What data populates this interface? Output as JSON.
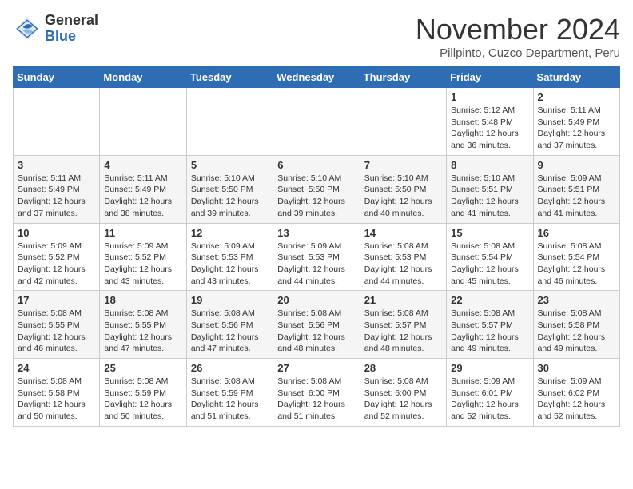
{
  "logo": {
    "general": "General",
    "blue": "Blue"
  },
  "header": {
    "title": "November 2024",
    "location": "Pillpinto, Cuzco Department, Peru"
  },
  "weekdays": [
    "Sunday",
    "Monday",
    "Tuesday",
    "Wednesday",
    "Thursday",
    "Friday",
    "Saturday"
  ],
  "weeks": [
    [
      {
        "day": "",
        "info": ""
      },
      {
        "day": "",
        "info": ""
      },
      {
        "day": "",
        "info": ""
      },
      {
        "day": "",
        "info": ""
      },
      {
        "day": "",
        "info": ""
      },
      {
        "day": "1",
        "info": "Sunrise: 5:12 AM\nSunset: 5:48 PM\nDaylight: 12 hours and 36 minutes."
      },
      {
        "day": "2",
        "info": "Sunrise: 5:11 AM\nSunset: 5:49 PM\nDaylight: 12 hours and 37 minutes."
      }
    ],
    [
      {
        "day": "3",
        "info": "Sunrise: 5:11 AM\nSunset: 5:49 PM\nDaylight: 12 hours and 37 minutes."
      },
      {
        "day": "4",
        "info": "Sunrise: 5:11 AM\nSunset: 5:49 PM\nDaylight: 12 hours and 38 minutes."
      },
      {
        "day": "5",
        "info": "Sunrise: 5:10 AM\nSunset: 5:50 PM\nDaylight: 12 hours and 39 minutes."
      },
      {
        "day": "6",
        "info": "Sunrise: 5:10 AM\nSunset: 5:50 PM\nDaylight: 12 hours and 39 minutes."
      },
      {
        "day": "7",
        "info": "Sunrise: 5:10 AM\nSunset: 5:50 PM\nDaylight: 12 hours and 40 minutes."
      },
      {
        "day": "8",
        "info": "Sunrise: 5:10 AM\nSunset: 5:51 PM\nDaylight: 12 hours and 41 minutes."
      },
      {
        "day": "9",
        "info": "Sunrise: 5:09 AM\nSunset: 5:51 PM\nDaylight: 12 hours and 41 minutes."
      }
    ],
    [
      {
        "day": "10",
        "info": "Sunrise: 5:09 AM\nSunset: 5:52 PM\nDaylight: 12 hours and 42 minutes."
      },
      {
        "day": "11",
        "info": "Sunrise: 5:09 AM\nSunset: 5:52 PM\nDaylight: 12 hours and 43 minutes."
      },
      {
        "day": "12",
        "info": "Sunrise: 5:09 AM\nSunset: 5:53 PM\nDaylight: 12 hours and 43 minutes."
      },
      {
        "day": "13",
        "info": "Sunrise: 5:09 AM\nSunset: 5:53 PM\nDaylight: 12 hours and 44 minutes."
      },
      {
        "day": "14",
        "info": "Sunrise: 5:08 AM\nSunset: 5:53 PM\nDaylight: 12 hours and 44 minutes."
      },
      {
        "day": "15",
        "info": "Sunrise: 5:08 AM\nSunset: 5:54 PM\nDaylight: 12 hours and 45 minutes."
      },
      {
        "day": "16",
        "info": "Sunrise: 5:08 AM\nSunset: 5:54 PM\nDaylight: 12 hours and 46 minutes."
      }
    ],
    [
      {
        "day": "17",
        "info": "Sunrise: 5:08 AM\nSunset: 5:55 PM\nDaylight: 12 hours and 46 minutes."
      },
      {
        "day": "18",
        "info": "Sunrise: 5:08 AM\nSunset: 5:55 PM\nDaylight: 12 hours and 47 minutes."
      },
      {
        "day": "19",
        "info": "Sunrise: 5:08 AM\nSunset: 5:56 PM\nDaylight: 12 hours and 47 minutes."
      },
      {
        "day": "20",
        "info": "Sunrise: 5:08 AM\nSunset: 5:56 PM\nDaylight: 12 hours and 48 minutes."
      },
      {
        "day": "21",
        "info": "Sunrise: 5:08 AM\nSunset: 5:57 PM\nDaylight: 12 hours and 48 minutes."
      },
      {
        "day": "22",
        "info": "Sunrise: 5:08 AM\nSunset: 5:57 PM\nDaylight: 12 hours and 49 minutes."
      },
      {
        "day": "23",
        "info": "Sunrise: 5:08 AM\nSunset: 5:58 PM\nDaylight: 12 hours and 49 minutes."
      }
    ],
    [
      {
        "day": "24",
        "info": "Sunrise: 5:08 AM\nSunset: 5:58 PM\nDaylight: 12 hours and 50 minutes."
      },
      {
        "day": "25",
        "info": "Sunrise: 5:08 AM\nSunset: 5:59 PM\nDaylight: 12 hours and 50 minutes."
      },
      {
        "day": "26",
        "info": "Sunrise: 5:08 AM\nSunset: 5:59 PM\nDaylight: 12 hours and 51 minutes."
      },
      {
        "day": "27",
        "info": "Sunrise: 5:08 AM\nSunset: 6:00 PM\nDaylight: 12 hours and 51 minutes."
      },
      {
        "day": "28",
        "info": "Sunrise: 5:08 AM\nSunset: 6:00 PM\nDaylight: 12 hours and 52 minutes."
      },
      {
        "day": "29",
        "info": "Sunrise: 5:09 AM\nSunset: 6:01 PM\nDaylight: 12 hours and 52 minutes."
      },
      {
        "day": "30",
        "info": "Sunrise: 5:09 AM\nSunset: 6:02 PM\nDaylight: 12 hours and 52 minutes."
      }
    ]
  ]
}
